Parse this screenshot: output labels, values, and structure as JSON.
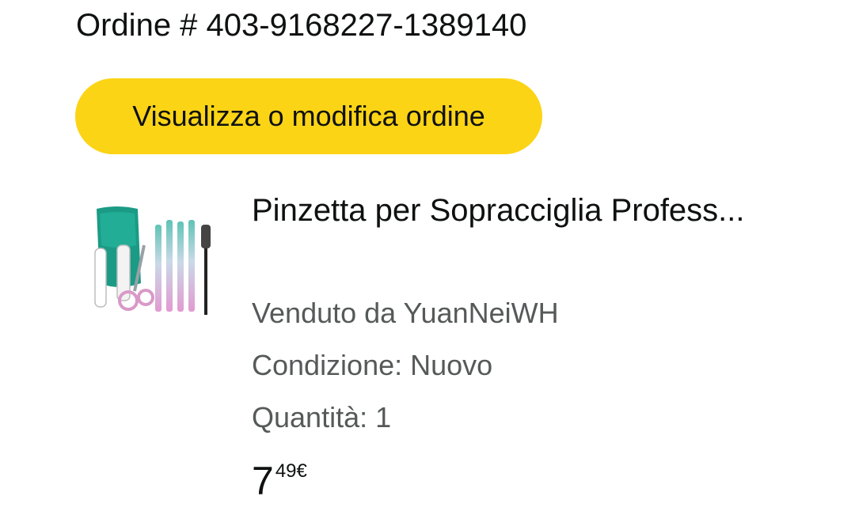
{
  "order": {
    "number_label": "Ordine # 403-9168227-1389140",
    "view_button_label": "Visualizza o modifica ordine"
  },
  "product": {
    "title": "Pinzetta per Sopracciglia Profess...",
    "image_icon": "eyebrow-tweezers-kit-thumbnail",
    "seller": "Venduto da YuanNeiWH",
    "condition": "Condizione: Nuovo",
    "quantity": "Quantità: 1",
    "price_whole": "7",
    "price_fraction": "49€"
  },
  "colors": {
    "button_yellow": "#fcd416",
    "text_primary": "#0f1111",
    "text_secondary": "#565959"
  }
}
